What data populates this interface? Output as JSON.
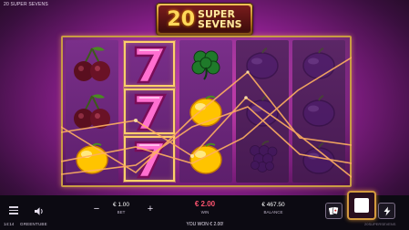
{
  "game": {
    "title": "20 SUPER SEVENS",
    "logo": {
      "number": "20",
      "word1": "SUPER",
      "word2": "SEVENS"
    }
  },
  "reels": [
    [
      "cherry",
      "cherry",
      "lemon"
    ],
    [
      "seven",
      "seven",
      "seven"
    ],
    [
      "clover",
      "lemon",
      "lemon"
    ],
    [
      "plum",
      "plum",
      "grapes"
    ],
    [
      "plum",
      "plum",
      "plum"
    ]
  ],
  "colors": {
    "accent_gold": "#c99b44",
    "win_text": "#ff5470",
    "payline": "#ffb060"
  },
  "bar": {
    "bet_value": "€ 1.00",
    "bet_label": "BET",
    "win_value": "€ 2.00",
    "win_label": "WIN",
    "balance_value": "€ 467.50",
    "balance_label": "BALANCE",
    "minus": "−",
    "plus": "+",
    "clock": "14:14",
    "brand": "GREENTUBE",
    "status_message": "YOU WON € 2.00!",
    "game_code": "20SUPERSEVENS"
  },
  "icons": {
    "menu": "menu-icon",
    "sound": "speaker-icon",
    "cards": "gamble-cards-icon",
    "spin": "spin-stop-icon",
    "turbo": "turbo-lightning-icon"
  }
}
